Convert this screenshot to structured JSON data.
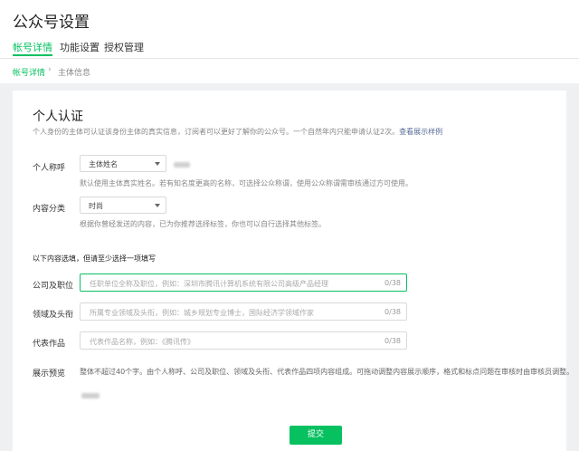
{
  "header": {
    "title": "公众号设置",
    "tabs": [
      {
        "label": "帐号详情",
        "active": true
      },
      {
        "label": "功能设置",
        "active": false
      },
      {
        "label": "授权管理",
        "active": false
      }
    ]
  },
  "breadcrumb": {
    "parent": "帐号详情",
    "separator": "›",
    "current": "主体信息"
  },
  "section": {
    "title": "个人认证",
    "description": "个人身份的主体可认证该身份主体的真实信息，订阅者可以更好了解你的公众号。一个自然年内只能申请认证2次。",
    "example_link": "查看展示样例"
  },
  "fields": {
    "nickname": {
      "label": "个人称呼",
      "select_value": "主体姓名",
      "hint": "默认使用主体真实姓名。若有知名度更高的名称，可选择公众称谓，使用公众称谓需审核通过方可使用。"
    },
    "category": {
      "label": "内容分类",
      "select_value": "时尚",
      "hint": "根据你曾经发送的内容，已为你推荐选择标签，你也可以自行选择其他标签。"
    }
  },
  "optional": {
    "title": "以下内容选填，但请至少选择一项填写",
    "company": {
      "label": "公司及职位",
      "placeholder": "任职单位全称及职位，例如：深圳市腾讯计算机系统有限公司高级产品经理",
      "count": "0/38"
    },
    "domain": {
      "label": "领域及头衔",
      "placeholder": "所属专业领域及头衔，例如：城乡规划专业博士，国际经济学领域作家",
      "count": "0/38"
    },
    "works": {
      "label": "代表作品",
      "placeholder": "代表作品名称，例如：《腾讯传》",
      "count": "0/38"
    }
  },
  "preview": {
    "label": "展示预览",
    "text": "整体不超过40个字。由个人称呼、公司及职位、领域及头衔、代表作品四项内容组成。可拖动调整内容展示顺序，格式和标点问题在审核时由审核员调整。"
  },
  "submit_label": "提交",
  "colors": {
    "accent": "#07c160",
    "link": "#576b95"
  }
}
